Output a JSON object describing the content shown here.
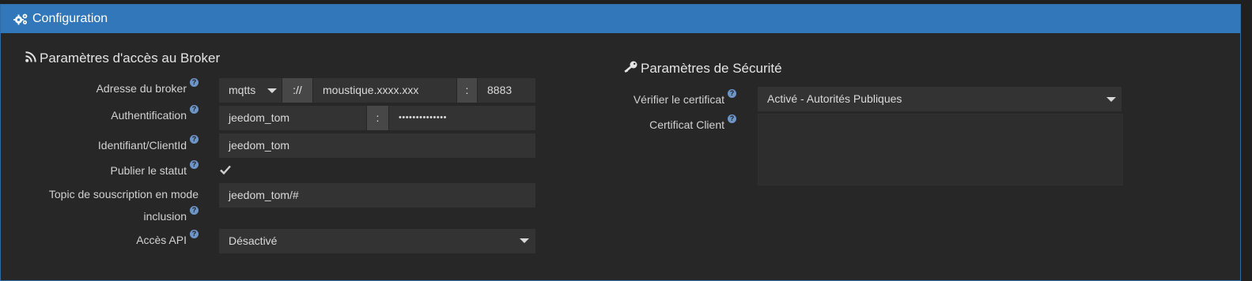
{
  "header": {
    "title": "Configuration",
    "icon": "cogs-icon"
  },
  "broker": {
    "title": "Paramètres d'accès au Broker",
    "icon": "rss-icon",
    "address_label": "Adresse du broker",
    "protocol": "mqtts",
    "separator": "://",
    "host": "moustique.xxxx.xxx",
    "port_separator": ":",
    "port": "8883",
    "auth_label": "Authentification",
    "username": "jeedom_tom",
    "auth_separator": ":",
    "password": "••••••••••••••",
    "clientid_label": "Identifiant/ClientId",
    "clientid": "jeedom_tom",
    "publish_label": "Publier le statut",
    "publish_checked": true,
    "topic_label_line1": "Topic de souscription en mode",
    "topic_label_line2": "inclusion",
    "topic": "jeedom_tom/#",
    "api_label": "Accès API",
    "api_value": "Désactivé"
  },
  "security": {
    "title": "Paramètres de Sécurité",
    "icon": "key-icon",
    "verify_label": "Vérifier le certificat",
    "verify_value": "Activé - Autorités Publiques",
    "client_cert_label": "Certificat Client",
    "client_cert_value": ""
  },
  "colors": {
    "header": "#3277b9",
    "panel": "#272727",
    "field": "#333333",
    "addon": "#474747",
    "help": "#6d95c6"
  }
}
